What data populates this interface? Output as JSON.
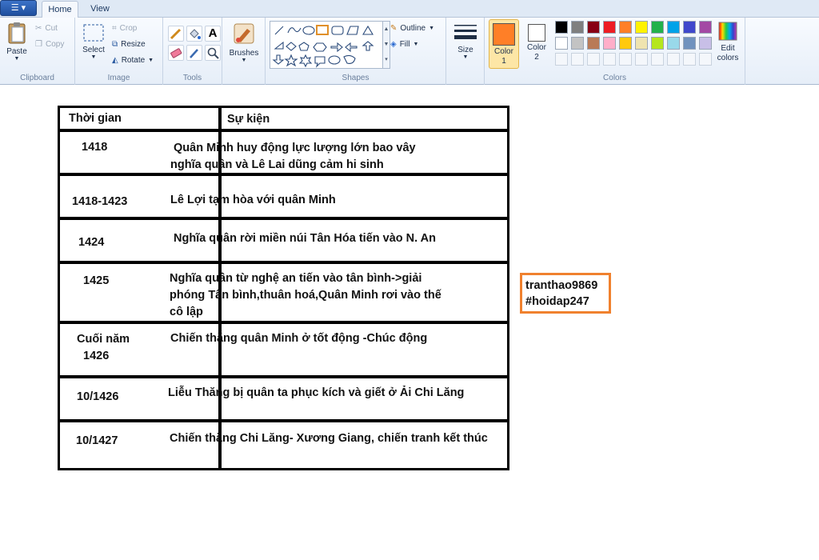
{
  "tabs": {
    "app_menu": "☰ ▾",
    "home": "Home",
    "view": "View"
  },
  "ribbon": {
    "clipboard": {
      "label": "Clipboard",
      "paste": "Paste",
      "cut": "Cut",
      "copy": "Copy"
    },
    "image": {
      "label": "Image",
      "select": "Select",
      "crop": "Crop",
      "resize": "Resize",
      "rotate": "Rotate"
    },
    "tools": {
      "label": "Tools"
    },
    "brushes": {
      "label": "Brushes"
    },
    "shapes": {
      "label": "Shapes",
      "outline": "Outline",
      "fill": "Fill"
    },
    "size": {
      "label": "Size"
    },
    "colors": {
      "label": "Colors",
      "color1_label": "Color 1",
      "color2_label": "Color 2",
      "edit_label": "Edit colors",
      "color1": "#ff7f27",
      "color2": "#ffffff",
      "palette_row1": [
        "#000000",
        "#7f7f7f",
        "#880015",
        "#ed1c24",
        "#ff7f27",
        "#fff200",
        "#22b14c",
        "#00a2e8",
        "#3f48cc",
        "#a349a4"
      ],
      "palette_row2": [
        "#ffffff",
        "#c3c3c3",
        "#b97a57",
        "#ffaec9",
        "#ffc90e",
        "#efe4b0",
        "#b5e61d",
        "#99d9ea",
        "#7092be",
        "#c8bfe7"
      ]
    }
  },
  "table": {
    "header": {
      "time": "Thời gian",
      "event": "Sự kiện"
    },
    "rows": [
      {
        "time": "1418",
        "event": [
          "Quân Minh huy động lực lượng lớn bao vây",
          "nghĩa quân và Lê Lai dũng cảm hi sinh"
        ]
      },
      {
        "time": "1418-1423",
        "event": [
          "Lê Lợi tạm hòa với quân Minh"
        ]
      },
      {
        "time": "1424",
        "event": [
          "Nghĩa quân rời miền núi Tân Hóa tiến vào N. An"
        ]
      },
      {
        "time": "1425",
        "event": [
          "Nghĩa quân từ nghệ an tiến vào tân bình->giải",
          "phóng Tân bình,thuân hoá,Quân Minh rơi vào thế",
          "cô lập"
        ]
      },
      {
        "time": [
          "Cuối năm",
          "1426"
        ],
        "event": [
          "Chiến thắng quân Minh ở tốt động -Chúc động"
        ]
      },
      {
        "time": "10/1426",
        "event": [
          "Liễu Thăng bị quân ta phục kích và giết ở Ải Chi Lăng"
        ]
      },
      {
        "time": "10/1427",
        "event": [
          "Chiến thắng Chi Lăng- Xương Giang, chiến tranh kết thúc"
        ]
      }
    ]
  },
  "stamp": {
    "line1": "tranthao9869",
    "line2": "#hoidap247"
  }
}
